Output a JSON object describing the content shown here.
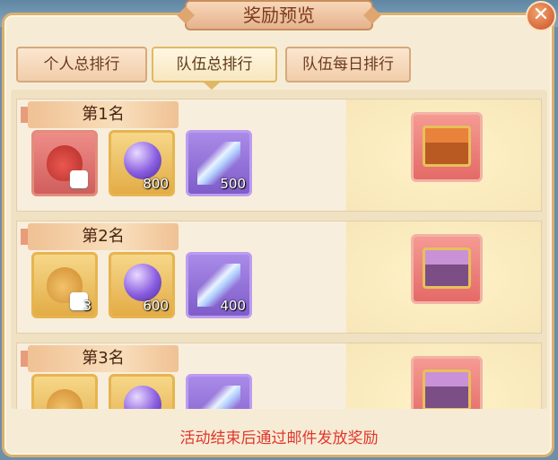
{
  "window": {
    "title": "奖励预览",
    "close_label": "✕"
  },
  "tabs": [
    {
      "label": "个人总排行",
      "active": false
    },
    {
      "label": "队伍总排行",
      "active": true
    },
    {
      "label": "队伍每日排行",
      "active": false
    }
  ],
  "ranks": [
    {
      "label": "第1名",
      "items": [
        {
          "icon": "red-lucky-bag-dice-icon",
          "quantity": ""
        },
        {
          "icon": "purple-orb-icon",
          "quantity": "800"
        },
        {
          "icon": "feather-icon",
          "quantity": "500"
        }
      ],
      "chest": "orange-treasure-chest-icon"
    },
    {
      "label": "第2名",
      "items": [
        {
          "icon": "gold-lucky-bag-dice-icon",
          "quantity": "3"
        },
        {
          "icon": "purple-orb-icon",
          "quantity": "600"
        },
        {
          "icon": "feather-icon",
          "quantity": "400"
        }
      ],
      "chest": "purple-treasure-chest-dice-icon"
    },
    {
      "label": "第3名",
      "items": [
        {
          "icon": "gold-lucky-bag-icon",
          "quantity": ""
        },
        {
          "icon": "purple-orb-icon",
          "quantity": ""
        },
        {
          "icon": "feather-icon",
          "quantity": ""
        }
      ],
      "chest": "purple-treasure-chest-dice-icon"
    }
  ],
  "footer": {
    "notice": "活动结束后通过邮件发放奖励"
  },
  "colors": {
    "notice": "#e0372c",
    "panel_bg": "#f6ecd6",
    "border": "#d9b071"
  }
}
